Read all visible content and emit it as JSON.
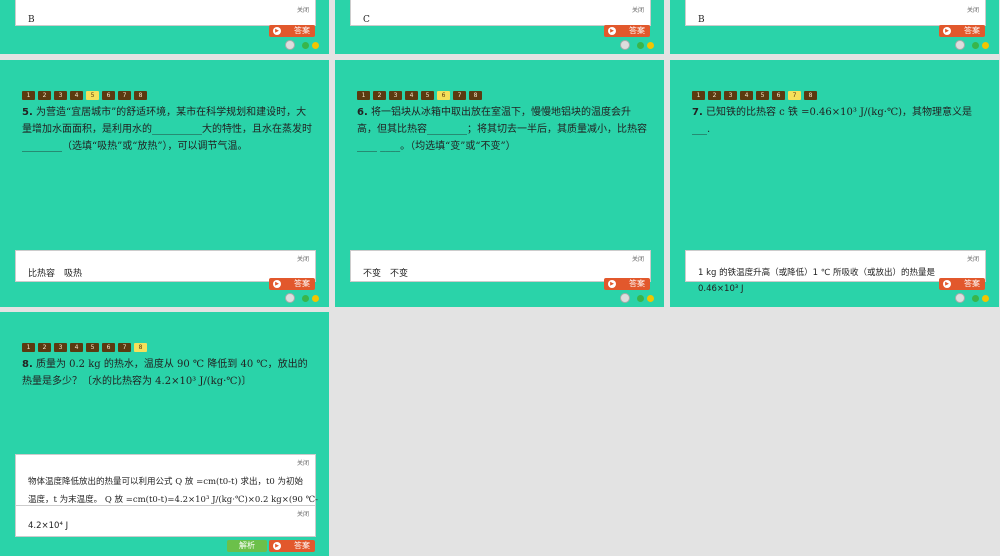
{
  "common": {
    "close_label": "关闭",
    "answer_button": "答案",
    "analysis_button": "解析"
  },
  "top_row": {
    "answers": [
      "B",
      "C",
      "B"
    ]
  },
  "nav_numbers": [
    "1",
    "2",
    "3",
    "4",
    "5",
    "6",
    "7",
    "8"
  ],
  "q5": {
    "number": "5.",
    "text": "为营造“宜居城市”的舒适环境，某市在科学规划和建设时，大量增加水面面积，是利用水的__________大的特性，且水在蒸发时________（选填“吸热”或“放热”），可以调节气温。",
    "answer": "比热容　吸热",
    "active": "5"
  },
  "q6": {
    "number": "6.",
    "text": "将一铝块从冰箱中取出放在室温下，慢慢地铝块的温度会升高，但其比热容________；将其切去一半后，其质量减小，比热容____ ____。（均选填“变”或“不变”）",
    "answer": "不变　不变",
    "active": "6"
  },
  "q7": {
    "number": "7.",
    "text": "已知铁的比热容 c 铁 =0.46×10³ J/(kg·℃)，其物理意义是___.",
    "answer_line1": "1 kg 的铁温度升高（或降低）1 ℃ 所吸收（或放出）的热量是",
    "answer_line2": "0.46×10³ J",
    "active": "7"
  },
  "q8": {
    "number": "8.",
    "text": "质量为 0.2 kg 的热水，温度从 90 ℃ 降低到 40 ℃，放出的热量是多少？〔水的比热容为 4.2×10³ J/(kg·℃)〕",
    "analysis_line1": "物体温度降低放出的热量可以利用公式 Q 放 =cm(t0-t) 求出，t0 为初始",
    "analysis_line2": "温度，t 为末温度。 Q 放 =cm(t0-t)=4.2×10³ J/(kg·℃)×0.2 kg×(90 ℃-",
    "answer": "4.2×10⁴ J",
    "active": "8"
  }
}
